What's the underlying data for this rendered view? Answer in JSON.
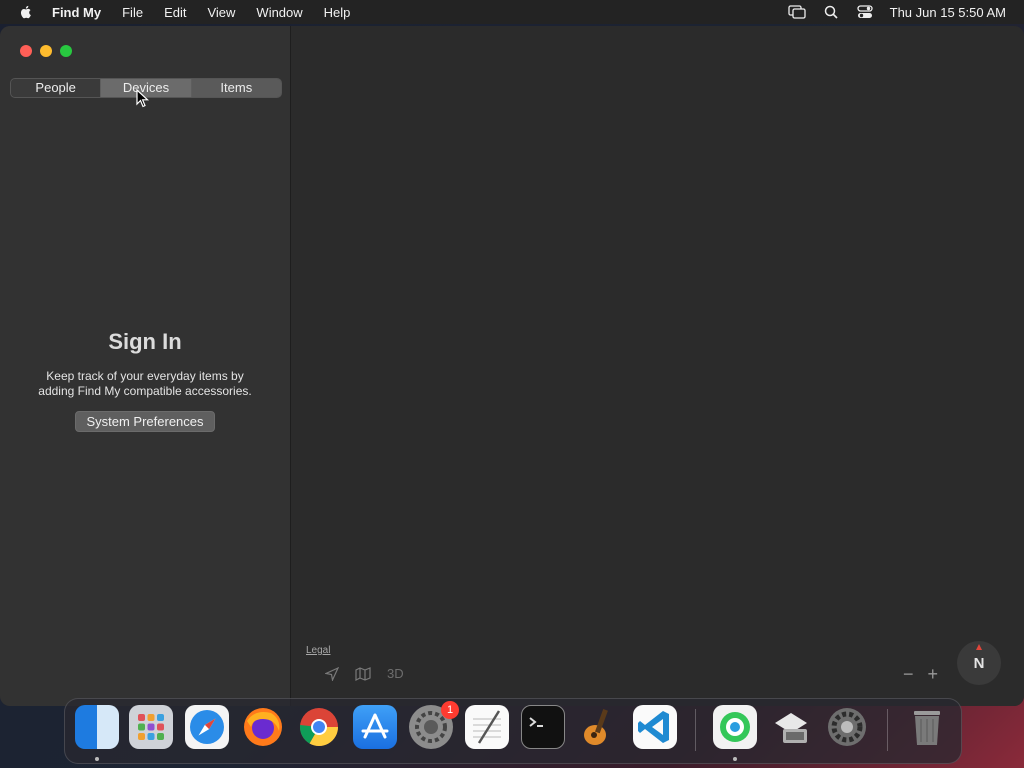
{
  "menubar": {
    "app_name": "Find My",
    "items": [
      "File",
      "Edit",
      "View",
      "Window",
      "Help"
    ],
    "clock": "Thu Jun 15  5:50 AM"
  },
  "sidebar": {
    "segments": [
      "People",
      "Devices",
      "Items"
    ],
    "selected_segment": "Devices",
    "signin_title": "Sign In",
    "signin_text": "Keep track of your everyday items by adding Find My compatible accessories.",
    "signin_button": "System Preferences"
  },
  "map": {
    "legal": "Legal",
    "three_d": "3D",
    "zoom_out": "−",
    "zoom_in": "+",
    "compass": "N"
  },
  "dock": {
    "apps": [
      "Finder",
      "Launchpad",
      "Safari",
      "Firefox",
      "Chrome",
      "App Store",
      "System Preferences",
      "TextEdit",
      "Terminal",
      "GarageBand",
      "Visual Studio Code",
      "Find My",
      "Migration Assistant",
      "System Preferences (2)",
      "Trash"
    ],
    "badge_system_prefs": "1"
  },
  "colors": {
    "close": "#ff5f57",
    "minimize": "#febc2e",
    "maximize": "#28c840",
    "badge": "#ff3b30"
  }
}
